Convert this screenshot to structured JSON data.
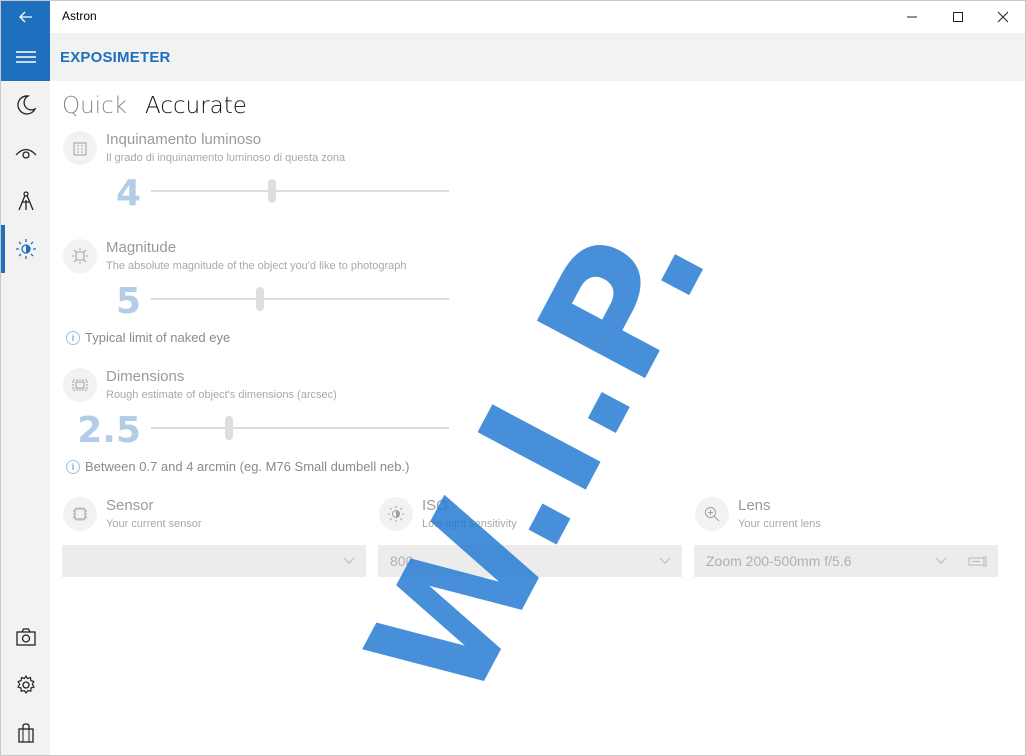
{
  "window": {
    "title": "Astron",
    "minimize_glyph": "─",
    "maximize_glyph": "☐",
    "close_glyph": "✕"
  },
  "header": {
    "title": "EXPOSIMETER"
  },
  "pivot": {
    "tabs": [
      {
        "label": "Quick"
      },
      {
        "label": "Accurate"
      }
    ],
    "selected": "Accurate"
  },
  "rail": {
    "items": [
      {
        "icon": "moon-icon"
      },
      {
        "icon": "eye-icon"
      },
      {
        "icon": "telescope-icon"
      },
      {
        "icon": "exposure-icon",
        "active": true
      }
    ],
    "bottom": [
      {
        "icon": "camera-icon"
      },
      {
        "icon": "gear-icon"
      },
      {
        "icon": "shopping-bag-icon"
      }
    ]
  },
  "settings": {
    "pollution": {
      "title": "Inquinamento luminoso",
      "desc": "Il grado di inquinamento luminoso di questa zona",
      "value": "4",
      "slider_fraction": 0.4
    },
    "magnitude": {
      "title": "Magnitude",
      "desc": "The absolute magnitude of the object you'd like to photograph",
      "value": "5",
      "slider_fraction": 0.36,
      "info": "Typical limit of naked eye"
    },
    "dimensions": {
      "title": "Dimensions",
      "desc": "Rough estimate of object's dimensions (arcsec)",
      "value": "2.5",
      "slider_fraction": 0.26,
      "info": "Between 0.7 and 4 arcmin (eg. M76 Small dumbell neb.)"
    }
  },
  "equipment": {
    "sensor": {
      "title": "Sensor",
      "desc": "Your current sensor",
      "value": ""
    },
    "iso": {
      "title": "ISO",
      "desc": "Low-light sensitivity",
      "value": "800"
    },
    "lens": {
      "title": "Lens",
      "desc": "Your current lens",
      "value": "Zoom 200-500mm f/5.6"
    }
  },
  "overlay": {
    "text": "W.I.P.",
    "color": "#1f78d1"
  },
  "colors": {
    "accent": "#1f6fbf",
    "rail_bg": "#f2f2f2"
  }
}
